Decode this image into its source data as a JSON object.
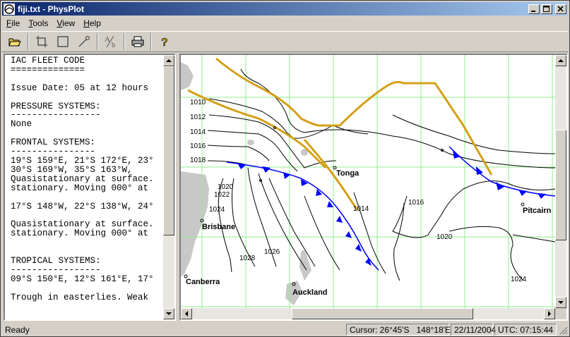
{
  "window": {
    "title": "fiji.txt - PhysPlot"
  },
  "menu": [
    {
      "key": "F",
      "rest": "ile"
    },
    {
      "key": "T",
      "rest": "ools"
    },
    {
      "key": "V",
      "rest": "iew"
    },
    {
      "key": "H",
      "rest": "elp"
    }
  ],
  "toolbar": {
    "buttons": [
      "open-folder-icon",
      "crop-icon",
      "rectangle-icon",
      "draw-pen-icon",
      "text-annotate-icon",
      "print-icon",
      "help-icon"
    ]
  },
  "bulletin": {
    "lines": [
      "IAC FLEET CODE",
      "==============",
      "",
      "Issue Date: 05 at 12 hours",
      "",
      "PRESSURE SYSTEMS:",
      "-----------------",
      "None",
      "",
      "FRONTAL SYSTEMS:",
      "----------------",
      "19°S 159°E, 21°S 172°E, 23°",
      "30°S 169°W, 35°S 163°W,",
      "Quasistationary at surface.",
      "stationary. Moving 000° at",
      "",
      "17°S 148°W, 22°S 138°W, 24°",
      "",
      "Quasistationary at surface.",
      "stationary. Moving 000° at",
      "",
      "",
      "TROPICAL SYSTEMS:",
      "-----------------",
      "09°S 150°E, 12°S 161°E, 17°",
      "",
      "Trough in easterlies. Weak"
    ]
  },
  "map": {
    "places": [
      "Tonga",
      "Pitcairn",
      "Brisbane",
      "Canberra",
      "Auckland"
    ],
    "isobars_left": [
      "1010",
      "1012",
      "1014",
      "1016",
      "1018"
    ],
    "isobar_labels": [
      "1020",
      "1022",
      "1024",
      "1026",
      "1028",
      "1014",
      "1016",
      "1020",
      "1024"
    ]
  },
  "status": {
    "ready": "Ready",
    "cursor": "Cursor: 26°45'S   148°18'E",
    "date": "22/11/2004",
    "utc": "UTC: 07:15:44"
  },
  "colors": {
    "trough": "#d4a017",
    "front": "#0000ff",
    "grid": "#90ee90",
    "land": "#c0c0c0"
  }
}
